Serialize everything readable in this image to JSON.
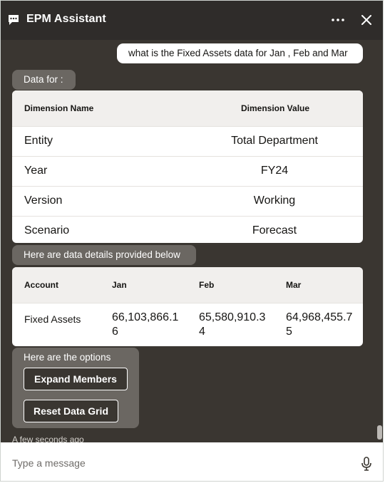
{
  "header": {
    "title": "EPM Assistant",
    "icons": [
      "chat-bubble-icon",
      "more-icon",
      "close-icon"
    ]
  },
  "conversation": {
    "user_message": "what is the Fixed Assets data for Jan , Feb and Mar",
    "data_for_label": "Data for :",
    "dimension_table": {
      "headers": [
        "Dimension Name",
        "Dimension Value"
      ],
      "rows": [
        {
          "name": "Entity",
          "value": "Total Department"
        },
        {
          "name": "Year",
          "value": "FY24"
        },
        {
          "name": "Version",
          "value": "Working"
        },
        {
          "name": "Scenario",
          "value": "Forecast"
        }
      ]
    },
    "details_label": "Here are data details provided below",
    "data_table": {
      "headers": [
        "Account",
        "Jan",
        "Feb",
        "Mar"
      ],
      "rows": [
        {
          "account": "Fixed Assets",
          "jan": "66,103,866.16",
          "feb": "65,580,910.34",
          "mar": "64,968,455.75"
        }
      ]
    },
    "options": {
      "title": "Here are the options",
      "buttons": [
        "Expand Members",
        "Reset Data Grid"
      ]
    },
    "timestamp": "A few seconds ago"
  },
  "footer": {
    "input_placeholder": "Type a message",
    "input_value": "",
    "mic_icon": "microphone-icon"
  },
  "colors": {
    "header_bg": "#2f2c2a",
    "conversation_bg": "#3a3631",
    "bot_bubble_bg": "#6b6762",
    "table_header_bg": "#f1efed"
  }
}
